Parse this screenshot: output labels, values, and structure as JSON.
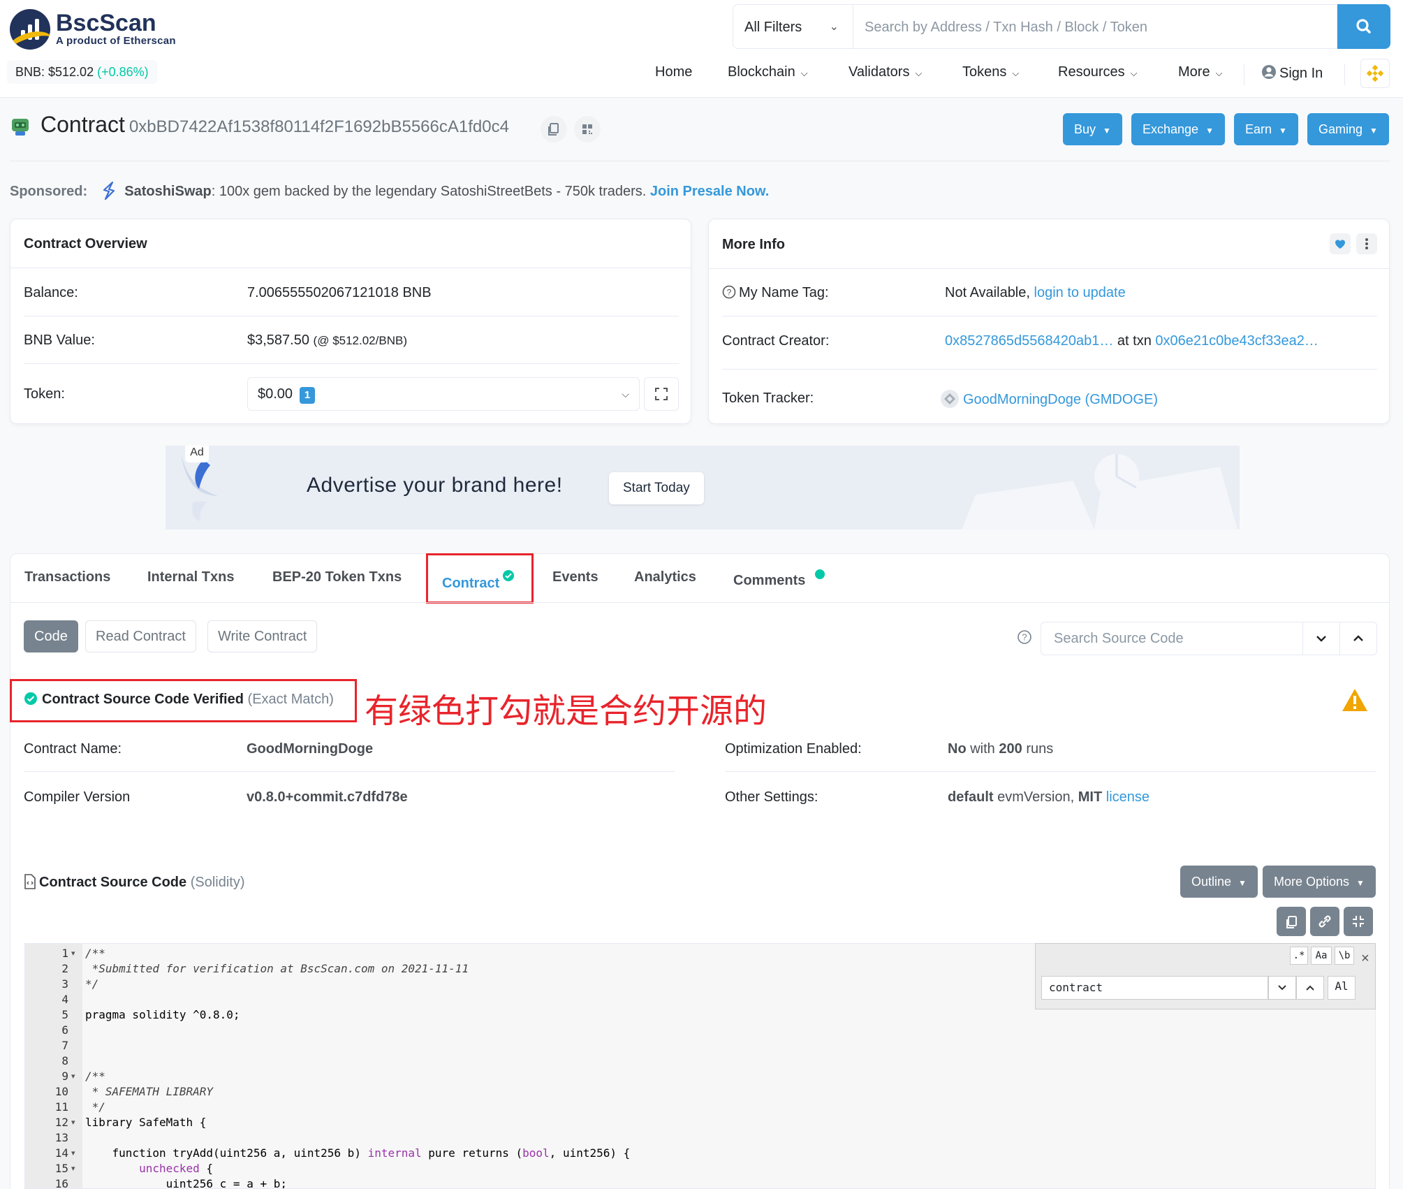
{
  "header": {
    "brand": "BscScan",
    "brand_sub": "A product of Etherscan",
    "price_label": "BNB: $512.02",
    "price_change": "(+0.86%)",
    "filter_label": "All Filters",
    "search_placeholder": "Search by Address / Txn Hash / Block / Token",
    "nav": {
      "home": "Home",
      "blockchain": "Blockchain",
      "validators": "Validators",
      "tokens": "Tokens",
      "resources": "Resources",
      "more": "More",
      "signin": "Sign In"
    }
  },
  "page": {
    "title": "Contract",
    "address": "0xbBD7422Af1538f80114f2F1692bB5566cA1fd0c4",
    "buttons": {
      "buy": "Buy",
      "exchange": "Exchange",
      "earn": "Earn",
      "gaming": "Gaming"
    }
  },
  "sponsor": {
    "label": "Sponsored:",
    "name": "SatoshiSwap",
    "text": ": 100x gem backed by the legendary SatoshiStreetBets - 750k traders.",
    "cta": "Join Presale Now."
  },
  "overview": {
    "title": "Contract Overview",
    "balance_label": "Balance:",
    "balance_value": "7.006555502067121018 BNB",
    "bnb_value_label": "BNB Value:",
    "bnb_value": "$3,587.50",
    "bnb_rate": "(@ $512.02/BNB)",
    "token_label": "Token:",
    "token_value": "$0.00",
    "token_count": "1"
  },
  "more_info": {
    "title": "More Info",
    "name_tag_label": "My Name Tag:",
    "name_tag_value": "Not Available,",
    "name_tag_link": "login to update",
    "creator_label": "Contract Creator:",
    "creator_address": "0x8527865d5568420ab1…",
    "creator_at": "at txn",
    "creator_txn": "0x06e21c0be43cf33ea2…",
    "tracker_label": "Token Tracker:",
    "tracker_value": "GoodMorningDoge (GMDOGE)"
  },
  "ad": {
    "badge": "Ad",
    "text": "Advertise your brand here!",
    "cta": "Start Today"
  },
  "tabs": {
    "transactions": "Transactions",
    "internal": "Internal Txns",
    "bep20": "BEP-20 Token Txns",
    "contract": "Contract",
    "events": "Events",
    "analytics": "Analytics",
    "comments": "Comments"
  },
  "subtabs": {
    "code": "Code",
    "read": "Read Contract",
    "write": "Write Contract",
    "search_placeholder": "Search Source Code"
  },
  "verified": {
    "text": "Contract Source Code Verified",
    "match": "(Exact Match)",
    "annotation": "有绿色打勾就是合约开源的"
  },
  "details": {
    "name_label": "Contract Name:",
    "name_value": "GoodMorningDoge",
    "compiler_label": "Compiler Version",
    "compiler_value": "v0.8.0+commit.c7dfd78e",
    "opt_label": "Optimization Enabled:",
    "opt_no": "No",
    "opt_with": "with",
    "opt_runs": "200",
    "opt_runs_word": "runs",
    "other_label": "Other Settings:",
    "other_default": "default",
    "other_evm": "evmVersion,",
    "other_mit": "MIT",
    "other_license": "license"
  },
  "source": {
    "title": "Contract Source Code",
    "lang": "(Solidity)",
    "outline": "Outline",
    "more_options": "More Options",
    "find_value": "contract",
    "find_regex": ".*",
    "find_case": "Aa",
    "find_word": "\\b",
    "find_all": "Al",
    "lines": [
      "/**",
      " *Submitted for verification at BscScan.com on 2021-11-11",
      "*/",
      "",
      "pragma solidity ^0.8.0;",
      "",
      "",
      "",
      "/**",
      " * SAFEMATH LIBRARY",
      " */",
      "library SafeMath {",
      "",
      "    function tryAdd(uint256 a, uint256 b) internal pure returns (bool, uint256) {",
      "        unchecked {",
      "            uint256 c = a + b;"
    ]
  },
  "colors": {
    "primary": "#3498db",
    "positive": "#00c9a7",
    "annotation_red": "#e8242b",
    "bnb_yellow": "#f0b90b",
    "navy": "#21325b"
  }
}
